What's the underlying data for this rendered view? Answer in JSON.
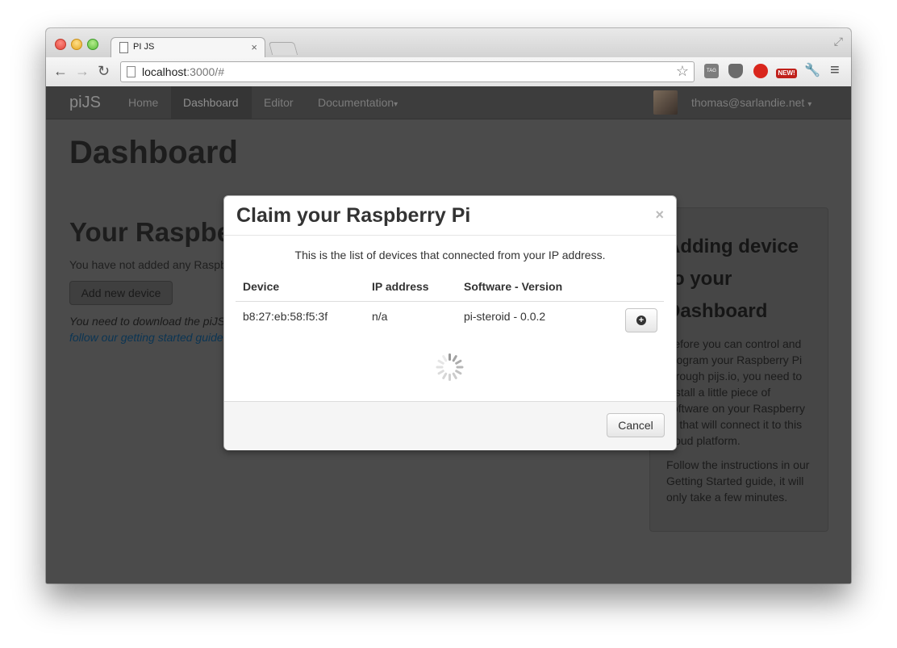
{
  "browser": {
    "tab_title": "PI JS",
    "tab_close": "×",
    "url_host": "localhost",
    "url_path": ":3000/#",
    "back_glyph": "←",
    "forward_glyph": "→",
    "reload_glyph": "↻",
    "star_glyph": "☆",
    "menu_glyph": "≡",
    "fullscreen_glyph": "⤢",
    "extensions": [
      {
        "name": "tag-extension-icon",
        "label": "TAG",
        "color": "#7d7d7d"
      },
      {
        "name": "pocket-extension-icon",
        "label": "",
        "color": "#6b6b6b"
      },
      {
        "name": "adblock-extension-icon",
        "label": "",
        "color": "#d9261c"
      },
      {
        "name": "new-extension-icon",
        "label": "NEW!",
        "color": "#c0201a"
      },
      {
        "name": "wrench-extension-icon",
        "label": "",
        "color": "#7a7a7a"
      }
    ]
  },
  "site": {
    "brand": "piJS",
    "nav": [
      "Home",
      "Dashboard",
      "Editor",
      "Documentation"
    ],
    "dropdown_caret": "▾",
    "user_email": "thomas@sarlandie.net"
  },
  "dashboard": {
    "title": "Dashboard",
    "section_title": "Your Raspberry",
    "no_devices_text": "You have not added any Raspb",
    "add_button": "Add new device",
    "download_text": "You need to download the piJS",
    "guide_link": "follow our getting started guide"
  },
  "sidebar": {
    "title": "Adding device to your Dashboard",
    "para1": "Before you can control and program your Raspberry Pi through pijs.io, you need to install a little piece of software on your Raspberry Pi that will connect it to this cloud platform.",
    "para2": "Follow the instructions in our Getting Started guide, it will only take a few minutes."
  },
  "modal": {
    "title": "Claim your Raspberry Pi",
    "close": "×",
    "intro": "This is the list of devices that connected from your IP address.",
    "columns": [
      "Device",
      "IP address",
      "Software - Version"
    ],
    "rows": [
      {
        "device": "b8:27:eb:58:f5:3f",
        "ip": "n/a",
        "software": "pi-steroid - 0.0.2"
      }
    ],
    "claim_glyph": "+",
    "cancel": "Cancel"
  }
}
